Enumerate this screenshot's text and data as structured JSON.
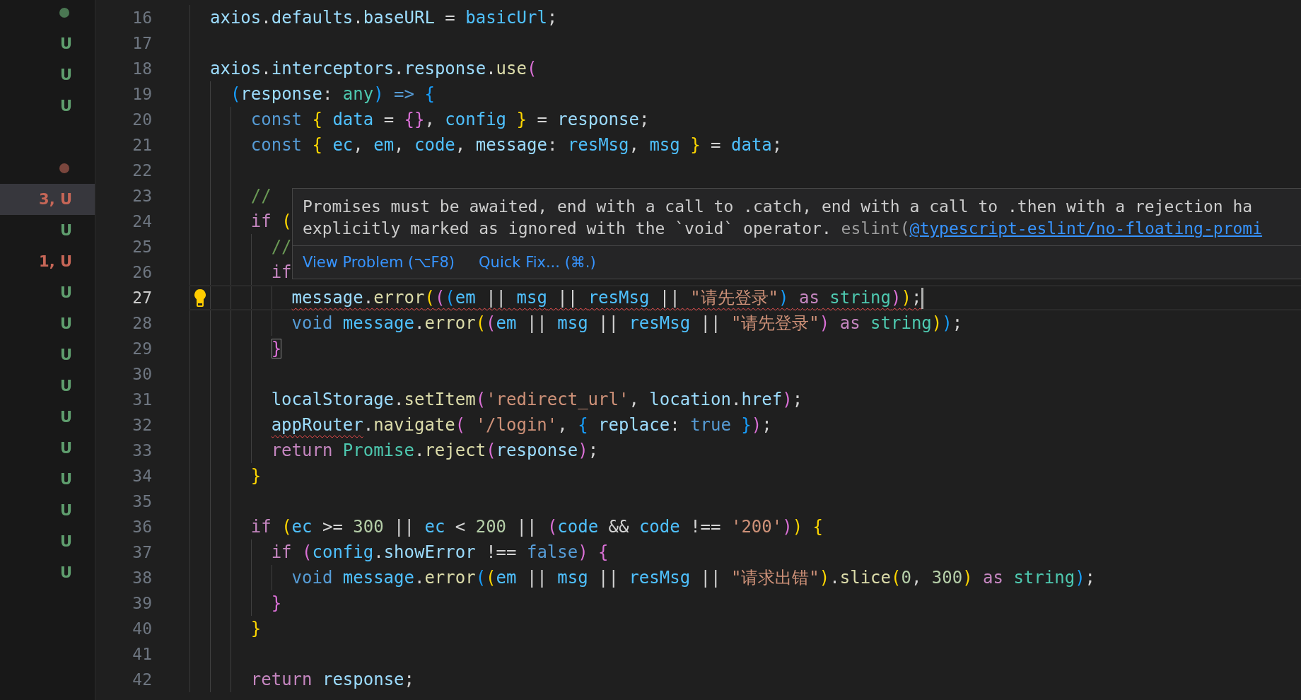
{
  "explorer": {
    "rows": [
      {
        "kind": "dot",
        "color": "#4a7752",
        "selected": false
      },
      {
        "kind": "badge",
        "text": "U",
        "color": "#5f9e6e",
        "selected": false
      },
      {
        "kind": "badge",
        "text": "U",
        "color": "#5f9e6e",
        "selected": false
      },
      {
        "kind": "badge",
        "text": "U",
        "color": "#5f9e6e",
        "selected": false
      },
      {
        "kind": "blank",
        "selected": false
      },
      {
        "kind": "dot",
        "color": "#7a463d",
        "selected": false
      },
      {
        "kind": "badge",
        "text": "3, U",
        "color": "#c66657",
        "selected": true
      },
      {
        "kind": "badge",
        "text": "U",
        "color": "#5f9e6e",
        "selected": false
      },
      {
        "kind": "badge",
        "text": "1, U",
        "color": "#c66657",
        "selected": false
      },
      {
        "kind": "badge",
        "text": "U",
        "color": "#5f9e6e",
        "selected": false
      },
      {
        "kind": "badge",
        "text": "U",
        "color": "#5f9e6e",
        "selected": false
      },
      {
        "kind": "badge",
        "text": "U",
        "color": "#5f9e6e",
        "selected": false
      },
      {
        "kind": "badge",
        "text": "U",
        "color": "#5f9e6e",
        "selected": false
      },
      {
        "kind": "badge",
        "text": "U",
        "color": "#5f9e6e",
        "selected": false
      },
      {
        "kind": "badge",
        "text": "U",
        "color": "#5f9e6e",
        "selected": false
      },
      {
        "kind": "badge",
        "text": "U",
        "color": "#5f9e6e",
        "selected": false
      },
      {
        "kind": "badge",
        "text": "U",
        "color": "#5f9e6e",
        "selected": false
      },
      {
        "kind": "badge",
        "text": "U",
        "color": "#5f9e6e",
        "selected": false
      },
      {
        "kind": "badge",
        "text": "U",
        "color": "#5f9e6e",
        "selected": false
      }
    ]
  },
  "editor": {
    "lines": [
      {
        "number": "16",
        "current": false,
        "tokens": [
          {
            "text": "axios",
            "color": "#9cdcfe"
          },
          {
            "text": ".",
            "color": "#d4d4d4"
          },
          {
            "text": "defaults",
            "color": "#9cdcfe"
          },
          {
            "text": ".",
            "color": "#d4d4d4"
          },
          {
            "text": "baseURL",
            "color": "#9cdcfe"
          },
          {
            "text": " = ",
            "color": "#d4d4d4"
          },
          {
            "text": "basicUrl",
            "color": "#4fc1ff"
          },
          {
            "text": ";",
            "color": "#d4d4d4"
          }
        ]
      },
      {
        "number": "17",
        "current": false
      },
      {
        "number": "18",
        "current": false,
        "tokens": [
          {
            "text": "axios",
            "color": "#9cdcfe"
          },
          {
            "text": ".",
            "color": "#d4d4d4"
          },
          {
            "text": "interceptors",
            "color": "#9cdcfe"
          },
          {
            "text": ".",
            "color": "#d4d4d4"
          },
          {
            "text": "response",
            "color": "#9cdcfe"
          },
          {
            "text": ".",
            "color": "#d4d4d4"
          },
          {
            "text": "use",
            "color": "#dcdcaa"
          },
          {
            "text": "(",
            "color": "#da70d6"
          }
        ]
      },
      {
        "number": "19",
        "current": false,
        "tokens": [
          {
            "text": "  (",
            "color": "#179fff"
          },
          {
            "text": "response",
            "color": "#9cdcfe"
          },
          {
            "text": ": ",
            "color": "#d4d4d4"
          },
          {
            "text": "any",
            "color": "#4ec9b0"
          },
          {
            "text": ")",
            "color": "#179fff"
          },
          {
            "text": " =>",
            "color": "#569cd6"
          },
          {
            "text": " {",
            "color": "#179fff"
          }
        ]
      },
      {
        "number": "20",
        "current": false,
        "tokens": [
          {
            "text": "    const",
            "color": "#569cd6"
          },
          {
            "text": " {",
            "color": "#ffd700"
          },
          {
            "text": " data",
            "color": "#4fc1ff"
          },
          {
            "text": " = ",
            "color": "#d4d4d4"
          },
          {
            "text": "{}",
            "color": "#da70d6"
          },
          {
            "text": ", ",
            "color": "#d4d4d4"
          },
          {
            "text": "config",
            "color": "#4fc1ff"
          },
          {
            "text": " }",
            "color": "#ffd700"
          },
          {
            "text": " = ",
            "color": "#d4d4d4"
          },
          {
            "text": "response",
            "color": "#9cdcfe"
          },
          {
            "text": ";",
            "color": "#d4d4d4"
          }
        ]
      },
      {
        "number": "21",
        "current": false,
        "tokens": [
          {
            "text": "    const",
            "color": "#569cd6"
          },
          {
            "text": " {",
            "color": "#ffd700"
          },
          {
            "text": " ec",
            "color": "#4fc1ff"
          },
          {
            "text": ", ",
            "color": "#d4d4d4"
          },
          {
            "text": "em",
            "color": "#4fc1ff"
          },
          {
            "text": ", ",
            "color": "#d4d4d4"
          },
          {
            "text": "code",
            "color": "#4fc1ff"
          },
          {
            "text": ", ",
            "color": "#d4d4d4"
          },
          {
            "text": "message",
            "color": "#9cdcfe"
          },
          {
            "text": ": ",
            "color": "#d4d4d4"
          },
          {
            "text": "resMsg",
            "color": "#4fc1ff"
          },
          {
            "text": ", ",
            "color": "#d4d4d4"
          },
          {
            "text": "msg",
            "color": "#4fc1ff"
          },
          {
            "text": " }",
            "color": "#ffd700"
          },
          {
            "text": " = ",
            "color": "#d4d4d4"
          },
          {
            "text": "data",
            "color": "#4fc1ff"
          },
          {
            "text": ";",
            "color": "#d4d4d4"
          }
        ]
      },
      {
        "number": "22",
        "current": false
      },
      {
        "number": "23",
        "current": false,
        "tokens": [
          {
            "text": "    //",
            "color": "#6a9955"
          }
        ]
      },
      {
        "number": "24",
        "current": false,
        "tokens": [
          {
            "text": "    if",
            "color": "#c586c0"
          },
          {
            "text": " (",
            "color": "#ffd700"
          }
        ]
      },
      {
        "number": "25",
        "current": false,
        "tokens": [
          {
            "text": "      //",
            "color": "#6a9955"
          }
        ]
      },
      {
        "number": "26",
        "current": false,
        "tokens": [
          {
            "text": "      if",
            "color": "#c586c0"
          }
        ]
      },
      {
        "number": "27",
        "current": true,
        "lightbulb": true,
        "cursor": true,
        "tokens": [
          {
            "text": "        message",
            "color": "#9cdcfe",
            "error": true
          },
          {
            "text": ".",
            "color": "#d4d4d4",
            "error": true
          },
          {
            "text": "error",
            "color": "#dcdcaa",
            "error": true
          },
          {
            "text": "(",
            "color": "#ffd700",
            "error": true
          },
          {
            "text": "(",
            "color": "#da70d6",
            "error": true
          },
          {
            "text": "(",
            "color": "#179fff",
            "error": true
          },
          {
            "text": "em",
            "color": "#4fc1ff",
            "error": true
          },
          {
            "text": " || ",
            "color": "#d4d4d4",
            "error": true
          },
          {
            "text": "msg",
            "color": "#4fc1ff",
            "error": true
          },
          {
            "text": " || ",
            "color": "#d4d4d4",
            "error": true
          },
          {
            "text": "resMsg",
            "color": "#4fc1ff",
            "error": true
          },
          {
            "text": " || ",
            "color": "#d4d4d4",
            "error": true
          },
          {
            "text": "\"请先登录\"",
            "color": "#ce9178",
            "error": true
          },
          {
            "text": ")",
            "color": "#179fff",
            "error": true
          },
          {
            "text": " as",
            "color": "#c586c0",
            "error": true
          },
          {
            "text": " string",
            "color": "#4ec9b0",
            "error": true
          },
          {
            "text": ")",
            "color": "#da70d6",
            "error": true
          },
          {
            "text": ")",
            "color": "#ffd700",
            "error": true
          },
          {
            "text": ";",
            "color": "#d4d4d4",
            "error": true
          }
        ]
      },
      {
        "number": "28",
        "current": false,
        "tokens": [
          {
            "text": "        void",
            "color": "#569cd6"
          },
          {
            "text": " message",
            "color": "#4fc1ff"
          },
          {
            "text": ".",
            "color": "#d4d4d4"
          },
          {
            "text": "error",
            "color": "#dcdcaa"
          },
          {
            "text": "(",
            "color": "#ffd700"
          },
          {
            "text": "(",
            "color": "#da70d6"
          },
          {
            "text": "em",
            "color": "#4fc1ff"
          },
          {
            "text": " || ",
            "color": "#d4d4d4"
          },
          {
            "text": "msg",
            "color": "#4fc1ff"
          },
          {
            "text": " || ",
            "color": "#d4d4d4"
          },
          {
            "text": "resMsg",
            "color": "#4fc1ff"
          },
          {
            "text": " || ",
            "color": "#d4d4d4"
          },
          {
            "text": "\"请先登录\"",
            "color": "#ce9178"
          },
          {
            "text": ")",
            "color": "#da70d6"
          },
          {
            "text": " as",
            "color": "#c586c0"
          },
          {
            "text": " string",
            "color": "#4ec9b0"
          },
          {
            "text": ")",
            "color": "#ffd700"
          },
          {
            "text": ")",
            "color": "#179fff"
          },
          {
            "text": ";",
            "color": "#d4d4d4"
          }
        ]
      },
      {
        "number": "29",
        "current": false,
        "tokens": [
          {
            "text": "      }",
            "color": "#da70d6",
            "matched": true
          }
        ]
      },
      {
        "number": "30",
        "current": false
      },
      {
        "number": "31",
        "current": false,
        "tokens": [
          {
            "text": "      localStorage",
            "color": "#9cdcfe"
          },
          {
            "text": ".",
            "color": "#d4d4d4"
          },
          {
            "text": "setItem",
            "color": "#dcdcaa"
          },
          {
            "text": "(",
            "color": "#da70d6"
          },
          {
            "text": "'redirect_url'",
            "color": "#ce9178"
          },
          {
            "text": ", ",
            "color": "#d4d4d4"
          },
          {
            "text": "location",
            "color": "#9cdcfe"
          },
          {
            "text": ".",
            "color": "#d4d4d4"
          },
          {
            "text": "href",
            "color": "#9cdcfe"
          },
          {
            "text": ")",
            "color": "#da70d6"
          },
          {
            "text": ";",
            "color": "#d4d4d4"
          }
        ]
      },
      {
        "number": "32",
        "current": false,
        "tokens": [
          {
            "text": "      appRouter",
            "color": "#9cdcfe",
            "error": true
          },
          {
            "text": ".",
            "color": "#d4d4d4"
          },
          {
            "text": "navigate",
            "color": "#dcdcaa"
          },
          {
            "text": "(",
            "color": "#da70d6"
          },
          {
            "text": " '/login'",
            "color": "#ce9178"
          },
          {
            "text": ", ",
            "color": "#d4d4d4"
          },
          {
            "text": "{",
            "color": "#179fff"
          },
          {
            "text": " replace",
            "color": "#9cdcfe"
          },
          {
            "text": ": ",
            "color": "#d4d4d4"
          },
          {
            "text": "true",
            "color": "#569cd6"
          },
          {
            "text": " }",
            "color": "#179fff"
          },
          {
            "text": ")",
            "color": "#da70d6"
          },
          {
            "text": ";",
            "color": "#d4d4d4"
          }
        ]
      },
      {
        "number": "33",
        "current": false,
        "tokens": [
          {
            "text": "      return",
            "color": "#c586c0"
          },
          {
            "text": " Promise",
            "color": "#4ec9b0"
          },
          {
            "text": ".",
            "color": "#d4d4d4"
          },
          {
            "text": "reject",
            "color": "#dcdcaa"
          },
          {
            "text": "(",
            "color": "#da70d6"
          },
          {
            "text": "response",
            "color": "#9cdcfe"
          },
          {
            "text": ")",
            "color": "#da70d6"
          },
          {
            "text": ";",
            "color": "#d4d4d4"
          }
        ]
      },
      {
        "number": "34",
        "current": false,
        "tokens": [
          {
            "text": "    }",
            "color": "#ffd700"
          }
        ]
      },
      {
        "number": "35",
        "current": false
      },
      {
        "number": "36",
        "current": false,
        "tokens": [
          {
            "text": "    if",
            "color": "#c586c0"
          },
          {
            "text": " (",
            "color": "#ffd700"
          },
          {
            "text": "ec",
            "color": "#4fc1ff"
          },
          {
            "text": " >= ",
            "color": "#d4d4d4"
          },
          {
            "text": "300",
            "color": "#b5cea8"
          },
          {
            "text": " || ",
            "color": "#d4d4d4"
          },
          {
            "text": "ec",
            "color": "#4fc1ff"
          },
          {
            "text": " < ",
            "color": "#d4d4d4"
          },
          {
            "text": "200",
            "color": "#b5cea8"
          },
          {
            "text": " || ",
            "color": "#d4d4d4"
          },
          {
            "text": "(",
            "color": "#da70d6"
          },
          {
            "text": "code",
            "color": "#4fc1ff"
          },
          {
            "text": " && ",
            "color": "#d4d4d4"
          },
          {
            "text": "code",
            "color": "#4fc1ff"
          },
          {
            "text": " !== ",
            "color": "#d4d4d4"
          },
          {
            "text": "'200'",
            "color": "#ce9178"
          },
          {
            "text": ")",
            "color": "#da70d6"
          },
          {
            "text": ")",
            "color": "#ffd700"
          },
          {
            "text": " {",
            "color": "#ffd700"
          }
        ]
      },
      {
        "number": "37",
        "current": false,
        "tokens": [
          {
            "text": "      if",
            "color": "#c586c0"
          },
          {
            "text": " (",
            "color": "#da70d6"
          },
          {
            "text": "config",
            "color": "#4fc1ff"
          },
          {
            "text": ".",
            "color": "#d4d4d4"
          },
          {
            "text": "showError",
            "color": "#9cdcfe"
          },
          {
            "text": " !== ",
            "color": "#d4d4d4"
          },
          {
            "text": "false",
            "color": "#569cd6"
          },
          {
            "text": ")",
            "color": "#da70d6"
          },
          {
            "text": " {",
            "color": "#da70d6"
          }
        ]
      },
      {
        "number": "38",
        "current": false,
        "tokens": [
          {
            "text": "        void",
            "color": "#569cd6"
          },
          {
            "text": " message",
            "color": "#4fc1ff"
          },
          {
            "text": ".",
            "color": "#d4d4d4"
          },
          {
            "text": "error",
            "color": "#dcdcaa"
          },
          {
            "text": "(",
            "color": "#179fff"
          },
          {
            "text": "(",
            "color": "#ffd700"
          },
          {
            "text": "em",
            "color": "#4fc1ff"
          },
          {
            "text": " || ",
            "color": "#d4d4d4"
          },
          {
            "text": "msg",
            "color": "#4fc1ff"
          },
          {
            "text": " || ",
            "color": "#d4d4d4"
          },
          {
            "text": "resMsg",
            "color": "#4fc1ff"
          },
          {
            "text": " || ",
            "color": "#d4d4d4"
          },
          {
            "text": "\"请求出错\"",
            "color": "#ce9178"
          },
          {
            "text": ")",
            "color": "#ffd700"
          },
          {
            "text": ".",
            "color": "#d4d4d4"
          },
          {
            "text": "slice",
            "color": "#dcdcaa"
          },
          {
            "text": "(",
            "color": "#ffd700"
          },
          {
            "text": "0",
            "color": "#b5cea8"
          },
          {
            "text": ", ",
            "color": "#d4d4d4"
          },
          {
            "text": "300",
            "color": "#b5cea8"
          },
          {
            "text": ")",
            "color": "#ffd700"
          },
          {
            "text": " as",
            "color": "#c586c0"
          },
          {
            "text": " string",
            "color": "#4ec9b0"
          },
          {
            "text": ")",
            "color": "#179fff"
          },
          {
            "text": ";",
            "color": "#d4d4d4"
          }
        ]
      },
      {
        "number": "39",
        "current": false,
        "tokens": [
          {
            "text": "      }",
            "color": "#da70d6"
          }
        ]
      },
      {
        "number": "40",
        "current": false,
        "tokens": [
          {
            "text": "    }",
            "color": "#ffd700"
          }
        ]
      },
      {
        "number": "41",
        "current": false
      },
      {
        "number": "42",
        "current": false,
        "tokens": [
          {
            "text": "    return",
            "color": "#c586c0"
          },
          {
            "text": " response",
            "color": "#9cdcfe"
          },
          {
            "text": ";",
            "color": "#d4d4d4"
          }
        ]
      }
    ]
  },
  "hover": {
    "message_lines": [
      "Promises must be awaited, end with a call to .catch, end with a call to .then with a rejection ha",
      "explicitly marked as ignored with the `void` operator."
    ],
    "source": "eslint(",
    "rule_link": "@typescript-eslint/no-floating-promi",
    "actions": [
      "View Problem (⌥F8)",
      "Quick Fix... (⌘.)"
    ]
  }
}
